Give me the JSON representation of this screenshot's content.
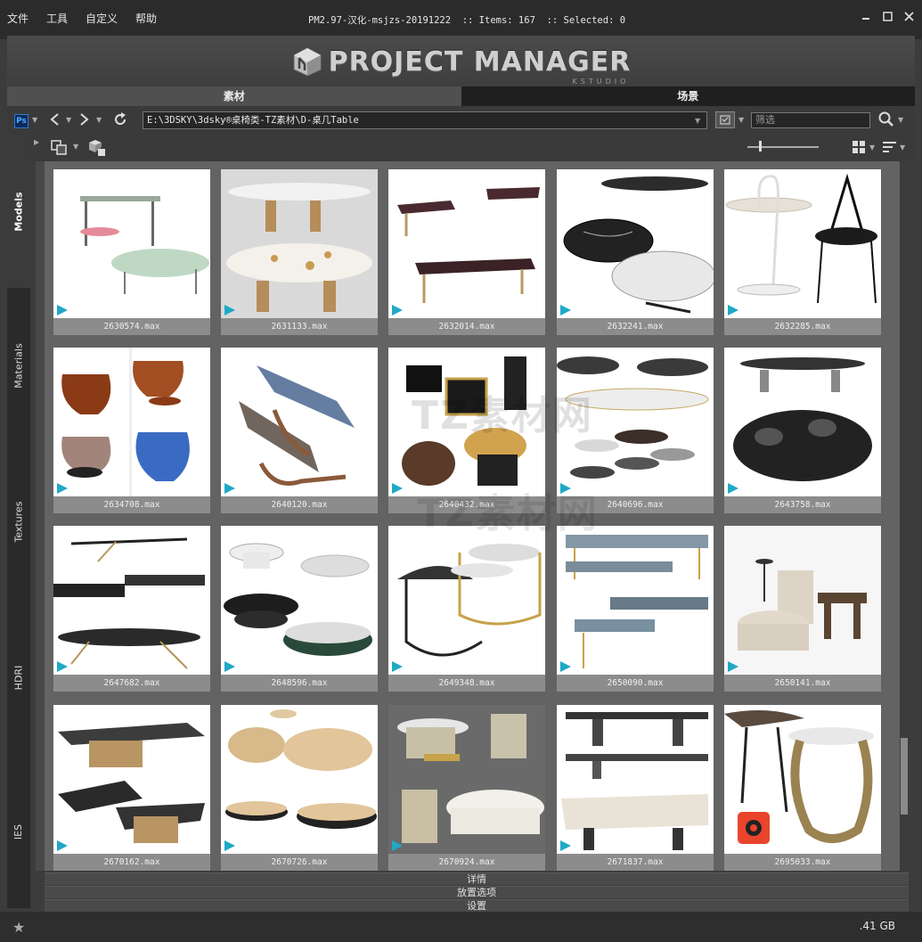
{
  "menu": [
    "文件",
    "工具",
    "自定义",
    "帮助"
  ],
  "window_title": "PM2.97-汉化-msjzs-20191222  :: Items: 167  :: Selected: 0",
  "logo": {
    "text": "PROJECT MANAGER",
    "sub": "KSTUDIO"
  },
  "tabs": [
    {
      "label": "素材",
      "active": true
    },
    {
      "label": "场景",
      "active": false
    }
  ],
  "pathbar": {
    "path": "E:\\3DSKY\\3dsky®桌椅类-TZ素材\\D-桌几Table",
    "filter_placeholder": "筛选"
  },
  "sidebar": [
    "Models",
    "Materials",
    "Textures",
    "HDRI",
    "IES"
  ],
  "items": [
    {
      "label": "2630574.max",
      "icon": "max"
    },
    {
      "label": "2631133.max",
      "icon": "max"
    },
    {
      "label": "2632014.max",
      "icon": "max"
    },
    {
      "label": "2632241.max",
      "icon": "max"
    },
    {
      "label": "2632285.max",
      "icon": "max"
    },
    {
      "label": "2634708.max",
      "icon": "max"
    },
    {
      "label": "2640120.max",
      "icon": "max"
    },
    {
      "label": "2640432.max",
      "icon": "max"
    },
    {
      "label": "2640696.max",
      "icon": "max"
    },
    {
      "label": "2643758.max",
      "icon": "max"
    },
    {
      "label": "2647682.max",
      "icon": "max"
    },
    {
      "label": "2648596.max",
      "icon": "max"
    },
    {
      "label": "2649348.max",
      "icon": "max"
    },
    {
      "label": "2650090.max",
      "icon": "max"
    },
    {
      "label": "2650141.max",
      "icon": "max"
    },
    {
      "label": "2670162.max",
      "icon": "max"
    },
    {
      "label": "2670726.max",
      "icon": "max"
    },
    {
      "label": "2670924.max",
      "icon": "max"
    },
    {
      "label": "2671837.max",
      "icon": "max"
    },
    {
      "label": "2695033.max",
      "icon": "corona"
    }
  ],
  "bottom_panels": [
    "详情",
    "放置选项",
    "设置"
  ],
  "status": {
    "disk": ".41 GB"
  },
  "colors": {
    "accent_max": "#1fa9c7",
    "corona": "#e8452c"
  }
}
